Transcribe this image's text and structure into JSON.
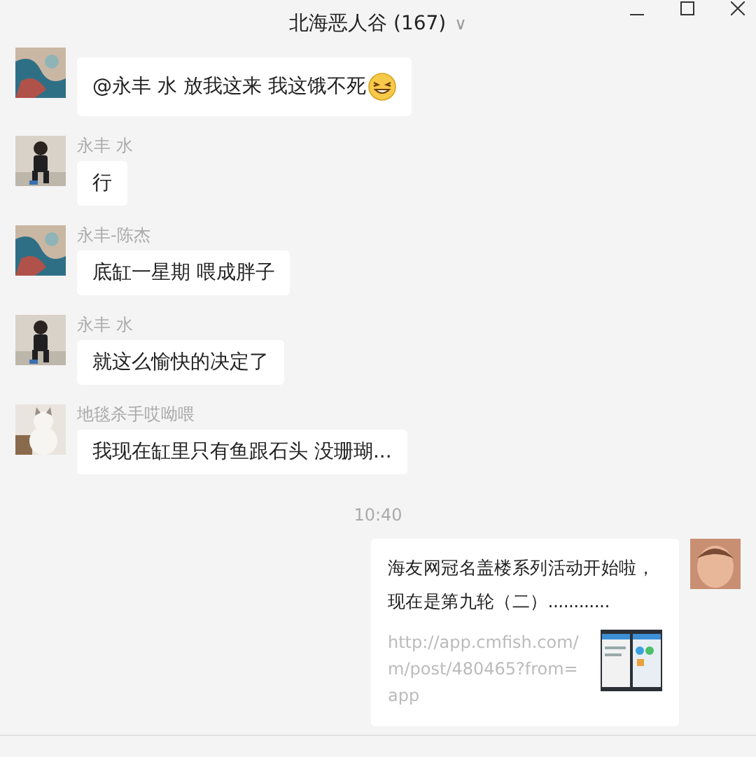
{
  "window": {
    "title": "北海恶人谷 (167)",
    "dropdown": "∨"
  },
  "messages": [
    {
      "text": "@永丰  水 放我这来  我这饿不死",
      "emoji": true
    },
    {
      "sender": "永丰  水",
      "text": "行",
      "emoji": false
    },
    {
      "sender": "永丰-陈杰",
      "text": "底缸一星期  喂成胖子",
      "emoji": false
    },
    {
      "sender": "永丰  水",
      "text": "就这么愉快的决定了",
      "emoji": false
    },
    {
      "sender": "地毯杀手哎呦喂",
      "text": "我现在缸里只有鱼跟石头 没珊瑚...",
      "emoji": false
    }
  ],
  "time": "10:40",
  "link_card": {
    "title": "海友网冠名盖楼系列活动开始啦，现在是第九轮（二）............",
    "url": "http://app.cmfish.com/m/post/480465?from=app"
  }
}
